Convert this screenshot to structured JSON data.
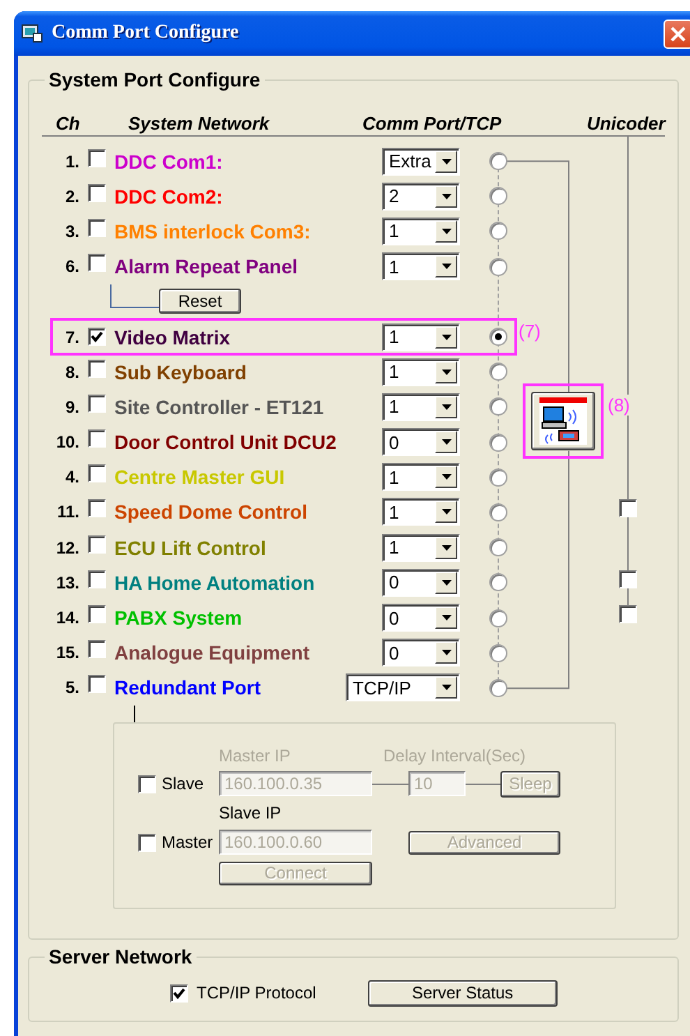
{
  "window": {
    "title": "Comm Port Configure"
  },
  "system_port": {
    "title": "System Port Configure",
    "columns": [
      "Ch",
      "System Network",
      "Comm Port/TCP",
      "Unicoder"
    ],
    "rows": [
      {
        "kind": "serial",
        "ch": "1.",
        "label": "DDC Com1:",
        "color": "#cc00cc",
        "checked": false,
        "port": "Extra",
        "selected": false
      },
      {
        "kind": "serial",
        "ch": "2.",
        "label": "DDC Com2:",
        "color": "#ff0000",
        "checked": false,
        "port": "2",
        "selected": false
      },
      {
        "kind": "serial",
        "ch": "3.",
        "label": "BMS interlock Com3:",
        "color": "#ff8000",
        "checked": false,
        "port": "1",
        "selected": false
      },
      {
        "kind": "serial",
        "ch": "6.",
        "label": "Alarm Repeat Panel",
        "color": "#800080",
        "checked": false,
        "port": "1",
        "selected": false,
        "reset_button": "Reset"
      },
      {
        "kind": "serial",
        "ch": "7.",
        "label": "Video Matrix",
        "color": "#400040",
        "checked": true,
        "port": "1",
        "selected": true,
        "callout": "(7)"
      },
      {
        "kind": "serial",
        "ch": "8.",
        "label": "Sub Keyboard",
        "color": "#804000",
        "checked": false,
        "port": "1",
        "selected": false
      },
      {
        "kind": "serial",
        "ch": "9.",
        "label": "Site Controller - ET121",
        "color": "#555555",
        "checked": false,
        "port": "1",
        "selected": false,
        "device_button": {
          "callout": "(8)"
        }
      },
      {
        "kind": "serial",
        "ch": "10.",
        "label": "Door Control Unit DCU2",
        "color": "#800000",
        "checked": false,
        "port": "0",
        "selected": false
      },
      {
        "kind": "serial",
        "ch": "4.",
        "label": "Centre Master GUI",
        "color": "#c8c800",
        "checked": false,
        "port": "1",
        "selected": false
      },
      {
        "kind": "serial",
        "ch": "11.",
        "label": "Speed Dome Control",
        "color": "#cc4400",
        "checked": false,
        "port": "1",
        "selected": false,
        "unicoder_checked": false
      },
      {
        "kind": "serial",
        "ch": "12.",
        "label": "ECU Lift Control",
        "color": "#808000",
        "checked": false,
        "port": "1",
        "selected": false
      },
      {
        "kind": "serial",
        "ch": "13.",
        "label": "HA Home Automation",
        "color": "#008080",
        "checked": false,
        "port": "0",
        "selected": false,
        "unicoder_checked": false
      },
      {
        "kind": "serial",
        "ch": "14.",
        "label": "PABX System",
        "color": "#00c000",
        "checked": false,
        "port": "0",
        "selected": false,
        "unicoder_checked": false
      },
      {
        "kind": "serial",
        "ch": "15.",
        "label": "Analogue Equipment",
        "color": "#804040",
        "checked": false,
        "port": "0",
        "selected": false
      },
      {
        "kind": "network",
        "ch": "5.",
        "label": "Redundant Port",
        "color": "#0000ff",
        "checked": false,
        "port": "TCP/IP",
        "selected": false
      }
    ],
    "redundancy": {
      "slave": {
        "label": "Slave",
        "checked": false
      },
      "master": {
        "label": "Master",
        "checked": false
      },
      "master_ip": {
        "label": "Master IP",
        "value": "160.100.0.35",
        "disabled": true
      },
      "delay": {
        "label": "Delay Interval(Sec)",
        "value": "10",
        "disabled": true
      },
      "sleep_button": {
        "label": "Sleep",
        "disabled": true
      },
      "slave_ip": {
        "label": "Slave IP",
        "value": "160.100.0.60",
        "disabled": true
      },
      "advanced_button": {
        "label": "Advanced",
        "disabled": true
      },
      "connect_button": {
        "label": "Connect",
        "disabled": true
      }
    }
  },
  "server_network": {
    "title": "Server Network",
    "tcp_ip": {
      "label": "TCP/IP Protocol",
      "checked": true
    },
    "status_button": "Server Status"
  }
}
